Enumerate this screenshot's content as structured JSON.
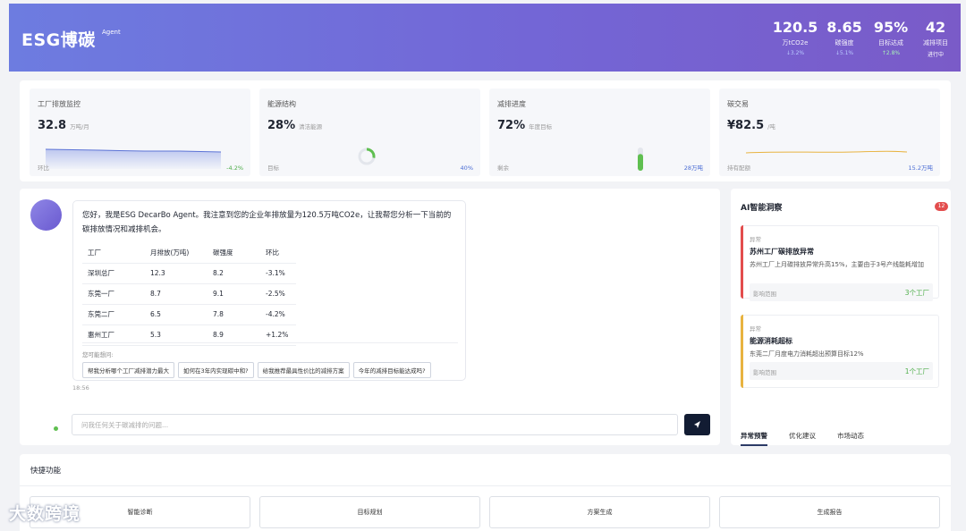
{
  "header": {
    "logo": "ESG博碳",
    "logo_sup": "Agent",
    "kpis": [
      {
        "value": "120.5",
        "label": "万tCO2e",
        "trend": "↓3.2%",
        "trend_dir": "down"
      },
      {
        "value": "8.65",
        "label": "碳强度",
        "trend": "↓5.1%",
        "trend_dir": "down"
      },
      {
        "value": "95%",
        "label": "目标达成",
        "trend": "↑2.8%",
        "trend_dir": "up"
      },
      {
        "value": "42",
        "label": "减排项目",
        "trend": "进行中",
        "trend_dir": "plain"
      }
    ]
  },
  "cards": [
    {
      "title": "工厂排放监控",
      "value": "32.8",
      "unit": "万吨/月",
      "foot_left": "环比",
      "foot_right": "-4.2%",
      "foot_right_color": "#4fae4a"
    },
    {
      "title": "能源结构",
      "value": "28%",
      "unit": "清洁能源",
      "foot_left": "目标",
      "foot_right": "40%",
      "foot_right_color": "#4a6cd4",
      "progress": 0.28
    },
    {
      "title": "减排进度",
      "value": "72%",
      "unit": "年度目标",
      "foot_left": "剩余",
      "foot_right": "28万吨",
      "foot_right_color": "#4a6cd4",
      "progress": 0.72
    },
    {
      "title": "碳交易",
      "value": "¥82.5",
      "unit": "/吨",
      "foot_left": "持有配额",
      "foot_right": "15.2万吨",
      "foot_right_color": "#4a6cd4"
    }
  ],
  "chat": {
    "message": "您好，我是ESG DecarBo Agent。我注意到您的企业年排放量为120.5万吨CO2e，让我帮您分析一下当前的碳排放情况和减排机会。",
    "table": {
      "headers": [
        "工厂",
        "月排放(万吨)",
        "碳强度",
        "环比"
      ],
      "rows": [
        [
          "深圳总厂",
          "12.3",
          "8.2",
          "-3.1%"
        ],
        [
          "东莞一厂",
          "8.7",
          "9.1",
          "-2.5%"
        ],
        [
          "东莞二厂",
          "6.5",
          "7.8",
          "-4.2%"
        ],
        [
          "惠州工厂",
          "5.3",
          "8.9",
          "+1.2%"
        ]
      ]
    },
    "hint": "您可能想问:",
    "suggestions": [
      "帮我分析哪个工厂减排潜力最大",
      "如何在3年内实现碳中和?",
      "给我推荐最具性价比的减排方案",
      "今年的减排目标能达成吗?"
    ],
    "time": "18:56",
    "input_placeholder": "问我任何关于碳减排的问题..."
  },
  "insights": {
    "title": "AI智能洞察",
    "badge": "12",
    "alerts": [
      {
        "tag": "异常",
        "title": "苏州工厂碳排放异常",
        "desc": "苏州工厂上月碳排放异常升高15%，主要由于3号产线能耗增加",
        "scope_label": "影响范围",
        "scope_value": "3个工厂",
        "color": "#e34d4d"
      },
      {
        "tag": "异常",
        "title": "能源消耗超标",
        "desc": "东莞二厂月度电力消耗超出预算目标12%",
        "scope_label": "影响范围",
        "scope_value": "1个工厂",
        "color": "#e8b340"
      }
    ],
    "tabs": [
      "异常预警",
      "优化建议",
      "市场动态"
    ]
  },
  "quick": {
    "title": "快捷功能",
    "buttons": [
      "智能诊断",
      "目标规划",
      "方案生成",
      "生成报告"
    ]
  },
  "watermark": "大数跨境"
}
